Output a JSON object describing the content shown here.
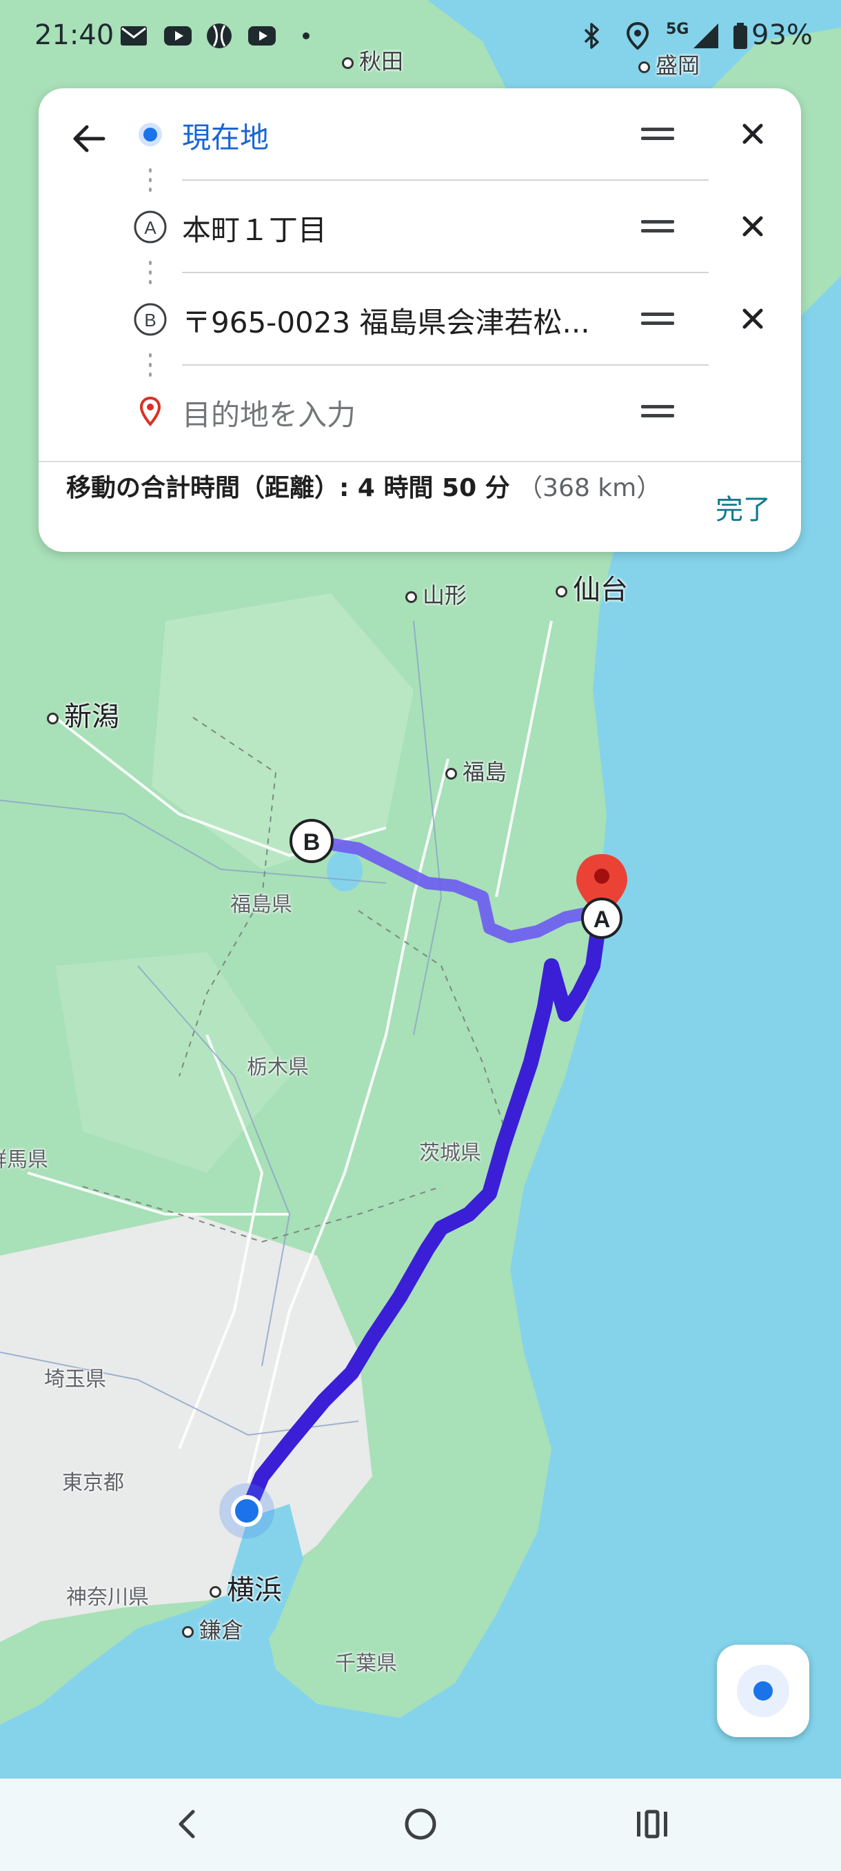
{
  "status_bar": {
    "time": "21:40",
    "network": "5G",
    "battery": "93%",
    "icons": [
      "mail-icon",
      "youtube-icon",
      "baseball-icon",
      "youtube-icon",
      "dot-icon",
      "bluetooth-icon",
      "location-icon",
      "signal-icon",
      "battery-icon"
    ]
  },
  "directions": {
    "origin": "現在地",
    "stop_a": "本町１丁目",
    "stop_b": "〒965-0023 福島県会津若松...",
    "destination_placeholder": "目的地を入力",
    "stop_a_marker": "A",
    "stop_b_marker": "B",
    "summary_label": "移動の合計時間（距離）: 4 時間 50 分",
    "summary_distance": "（368 km）",
    "done_label": "完了"
  },
  "map": {
    "places": {
      "akita": "秋田",
      "morioka": "盛岡",
      "yamagata": "山形",
      "sendai": "仙台",
      "niigata": "新潟",
      "fukushima": "福島",
      "fukushima_pref": "福島県",
      "tochigi_pref": "栃木県",
      "gunma_pref": "群馬県",
      "ibaraki_pref": "茨城県",
      "saitama_pref": "埼玉県",
      "tokyo": "東京都",
      "kanagawa_pref": "神奈川県",
      "yokohama": "横浜",
      "kamakura": "鎌倉",
      "chiba_pref": "千葉県"
    },
    "route_markers": {
      "a": "A",
      "b": "B"
    },
    "colors": {
      "water": "#84d3ea",
      "land": "#a8e0b8",
      "urban": "#e9eaea",
      "route": "#3a1fd6",
      "route_alt": "#6b5bf2",
      "pin": "#ea4335"
    }
  },
  "nav_bar": {
    "buttons": [
      "back-icon",
      "home-icon",
      "recents-icon"
    ]
  }
}
